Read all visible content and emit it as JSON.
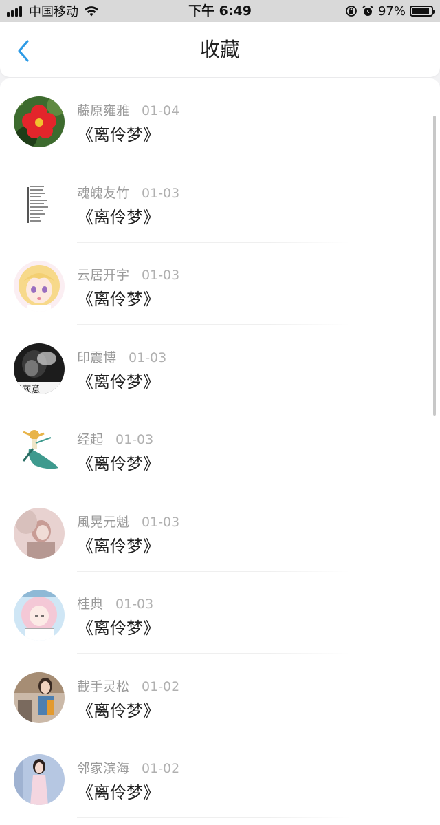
{
  "status_bar": {
    "carrier": "中国移动",
    "time": "下午 6:49",
    "battery": "97%",
    "battery_level": 0.97
  },
  "nav": {
    "title": "收藏",
    "back_icon": "chevron-left-icon"
  },
  "favorites": [
    {
      "author": "藤原雍雅",
      "date": "01-04",
      "title": "《离伶梦》",
      "avatar": "red-flower"
    },
    {
      "author": "魂魄友竹",
      "date": "01-03",
      "title": "《离伶梦》",
      "avatar": "text-document"
    },
    {
      "author": "云居开宇",
      "date": "01-03",
      "title": "《离伶梦》",
      "avatar": "anime-girl-blonde"
    },
    {
      "author": "印震博",
      "date": "01-03",
      "title": "《离伶梦》",
      "avatar": "dark-photo"
    },
    {
      "author": "经起",
      "date": "01-03",
      "title": "《离伶梦》",
      "avatar": "dancer-illustration"
    },
    {
      "author": "風晃元魁",
      "date": "01-03",
      "title": "《离伶梦》",
      "avatar": "pink-portrait"
    },
    {
      "author": "桂典",
      "date": "01-03",
      "title": "《离伶梦》",
      "avatar": "anime-girl-pink"
    },
    {
      "author": "截手灵松",
      "date": "01-02",
      "title": "《离伶梦》",
      "avatar": "woman-photo"
    },
    {
      "author": "邻家滨海",
      "date": "01-02",
      "title": "《离伶梦》",
      "avatar": "girl-photo"
    }
  ]
}
